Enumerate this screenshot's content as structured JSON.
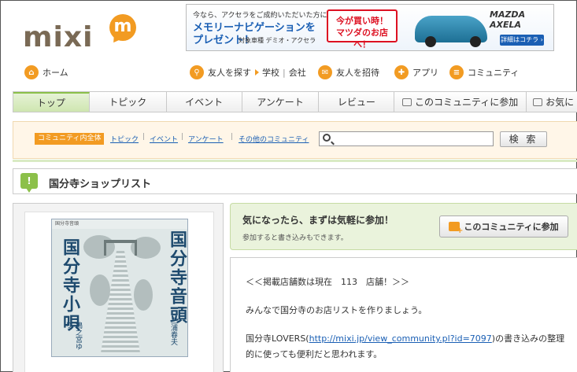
{
  "logo": {
    "word": "mixi",
    "mark": "m"
  },
  "ad": {
    "line1": "今なら、アクセラをご成約いただいた方に",
    "line2": "メモリーナビゲーションを",
    "line3": "プレゼント！",
    "note": "対象車種 デミオ・アクセラ",
    "callout1": "今が買い時！",
    "callout2": "マツダのお店へ！",
    "brand": "MAZDA AXELA",
    "detail": "詳細はコチラ ›"
  },
  "global_nav": {
    "home": "ホーム",
    "find_friends": "友人を探す",
    "school": "学校",
    "company": "会社",
    "invite": "友人を招待",
    "apps": "アプリ",
    "community": "コミュニティ"
  },
  "tabs": [
    "トップ",
    "トピック",
    "イベント",
    "アンケート",
    "レビュー",
    "このコミュニティに参加",
    "お気に"
  ],
  "subnav": {
    "scope": "コミュニティ内全体",
    "links": [
      "トピック",
      "イベント",
      "アンケート",
      "その他のコミュニティ"
    ],
    "search_value": "",
    "search_button": "検 索"
  },
  "page": {
    "title": "国分寺ショップリスト"
  },
  "cover": {
    "header": "国分寺音頭",
    "title_right": "国分寺音頭",
    "title_left": "国分寺小唄",
    "singer_right": "三浦春夫",
    "singer_left": "鳩之宮ゆり"
  },
  "join": {
    "heading": "気になったら、まずは気軽に参加！",
    "sub": "参加すると書き込みもできます。",
    "button": "このコミュニティに参加"
  },
  "description": {
    "line1": "＜＜掲載店舗数は現在　113　店舗！＞＞",
    "line2": "みんなで国分寺のお店リストを作りましょう。",
    "line3_pre": "国分寺LOVERS(",
    "line3_link": "http://mixi.jp/view_community.pl?id=7097",
    "line3_post": ")の書き込みの整理",
    "line4": "的に使っても便利だと思われます。"
  }
}
